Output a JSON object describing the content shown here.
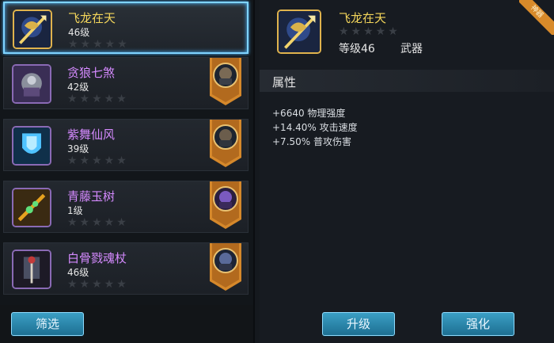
{
  "equipment_list": [
    {
      "name": "飞龙在天",
      "level": "46级",
      "stars": "★★★★★",
      "selected": true,
      "has_hero": false,
      "name_color": "gold"
    },
    {
      "name": "贪狼七煞",
      "level": "42级",
      "stars": "★★★★★",
      "selected": false,
      "has_hero": true,
      "name_color": "purple"
    },
    {
      "name": "紫舞仙风",
      "level": "39级",
      "stars": "★★★★★",
      "selected": false,
      "has_hero": true,
      "name_color": "purple"
    },
    {
      "name": "青藤玉树",
      "level": "1级",
      "stars": "★★★★★",
      "selected": false,
      "has_hero": true,
      "name_color": "purple"
    },
    {
      "name": "白骨戮魂杖",
      "level": "46级",
      "stars": "★★★★★",
      "selected": false,
      "has_hero": true,
      "name_color": "purple"
    }
  ],
  "filter_button": "筛选",
  "detail": {
    "name": "飞龙在天",
    "stars": "★★★★★",
    "level_label": "等级46",
    "type": "武器",
    "corner_tag": "神器",
    "section_title": "属性",
    "attributes": [
      "+6640 物理强度",
      "+14.40% 攻击速度",
      "+7.50% 普攻伤害"
    ]
  },
  "buttons": {
    "upgrade": "升级",
    "enhance": "强化"
  },
  "colors": {
    "gold_text": "#f4d65b",
    "purple_text": "#d58aff",
    "button": "#2a89b0",
    "selected_glow": "#7fd3ff"
  }
}
